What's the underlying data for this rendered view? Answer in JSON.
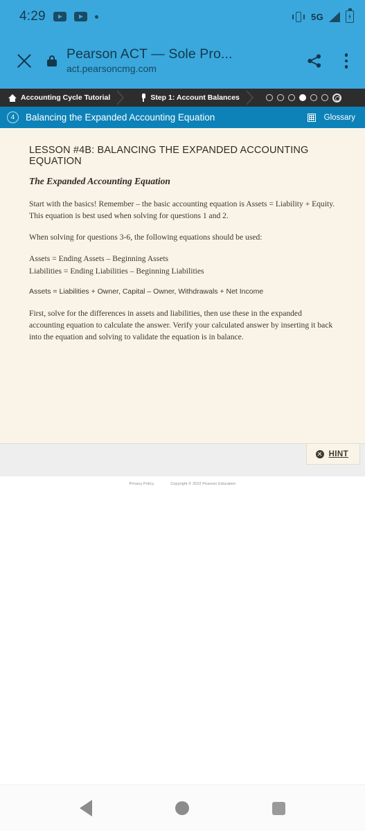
{
  "status_bar": {
    "time": "4:29",
    "left_icons": [
      "youtube-icon",
      "youtube-icon",
      "dot-icon"
    ],
    "network_label": "5G",
    "right_icons": [
      "vibrate-icon",
      "signal-icon",
      "battery-icon"
    ]
  },
  "browser": {
    "close_icon": "close-icon",
    "lock_icon": "lock-icon",
    "title": "Pearson ACT — Sole Pro...",
    "url": "act.pearsoncmg.com",
    "share_icon": "share-icon",
    "menu_icon": "overflow-menu-icon"
  },
  "breadcrumb": {
    "items": [
      {
        "label": "Accounting Cycle Tutorial",
        "icon": "home-icon"
      },
      {
        "label": "Step 1: Account Balances",
        "icon": "pin-icon"
      }
    ],
    "progress_dots": [
      {
        "state": "empty"
      },
      {
        "state": "empty"
      },
      {
        "state": "empty"
      },
      {
        "state": "filled"
      },
      {
        "state": "empty"
      },
      {
        "state": "empty"
      },
      {
        "state": "target"
      }
    ]
  },
  "lesson_bar": {
    "badge": "4",
    "title": "Balancing the Expanded Accounting Equation",
    "glossary_icon": "grid-table-icon",
    "glossary_label": "Glossary"
  },
  "content": {
    "heading": "LESSON #4B: BALANCING THE EXPANDED ACCOUNTING EQUATION",
    "subheading": "The Expanded Accounting Equation",
    "paragraph_1": "Start with the basics! Remember – the basic accounting equation is Assets = Liability + Equity. This equation is best used when solving for questions 1 and 2.",
    "paragraph_2": "When solving for questions 3-6, the following equations should be used:",
    "equation_1": "Assets = Ending Assets – Beginning Assets",
    "equation_2": "Liabilities = Ending Liabilities – Beginning Liabilities",
    "equation_3": "Assets = Liabilities + Owner, Capital – Owner, Withdrawals + Net Income",
    "paragraph_3": "First, solve for the differences in assets and liabilities, then use these in the expanded accounting equation to calculate the answer. Verify your calculated answer by inserting it back into the equation and solving to validate the equation is in balance."
  },
  "hint": {
    "icon": "close-circle-icon",
    "label": "HINT"
  },
  "page_footer": {
    "privacy_link": "Privacy Policy",
    "copyright": "Copyright © 2022 Pearson Education"
  },
  "android_nav": {
    "back": "back-triangle-icon",
    "home": "home-circle-icon",
    "recents": "recents-square-icon"
  },
  "colors": {
    "status_bar_bg": "#3aa8dd",
    "breadcrumb_bg": "#2d2d2d",
    "lesson_bar_bg": "#0d82b8",
    "content_bg": "#faf4e8",
    "hint_bar_bg": "#eeeeee"
  }
}
